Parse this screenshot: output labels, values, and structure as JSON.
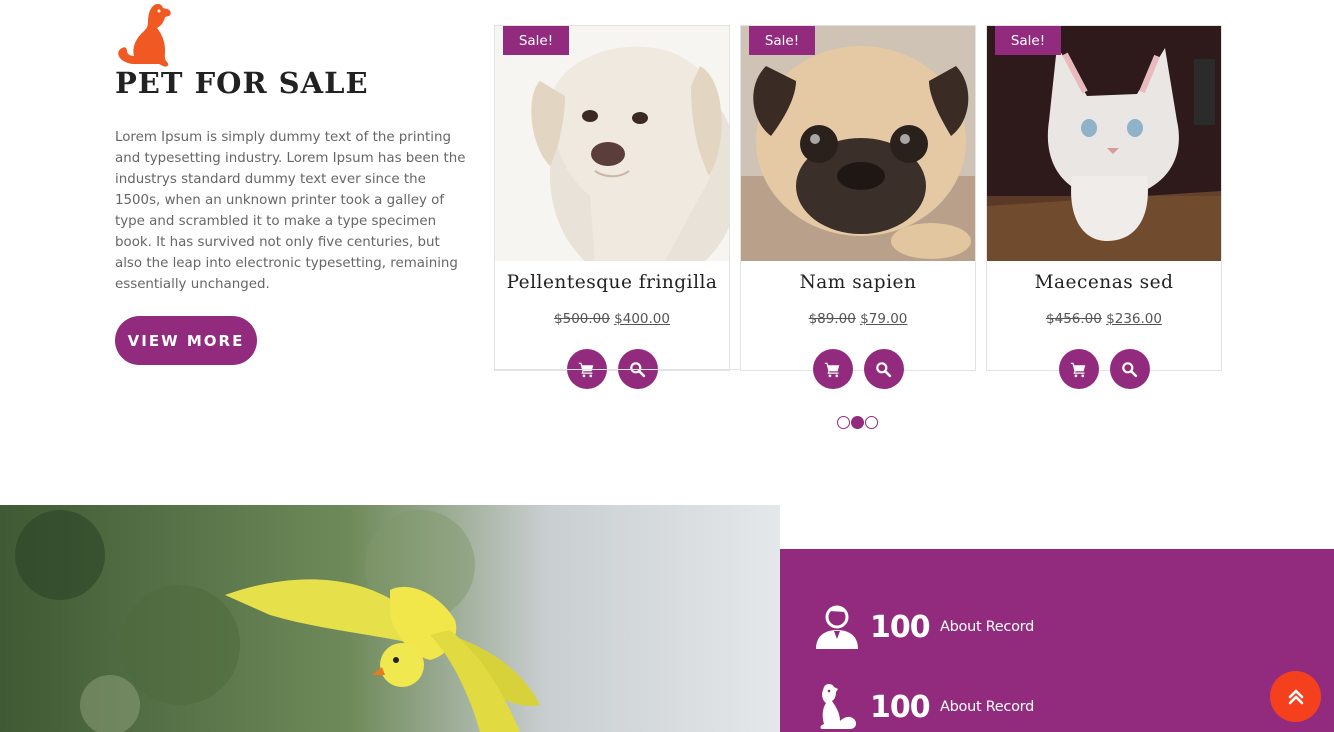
{
  "intro": {
    "title": "PET FOR SALE",
    "description": "Lorem Ipsum is simply dummy text of the printing and typesetting industry. Lorem Ipsum has been the industrys standard dummy text ever since the 1500s, when an unknown printer took a galley of type and scrambled it to make a type specimen book. It has survived not only five centuries, but also the leap into electronic typesetting, remaining essentially unchanged.",
    "button_label": "VIEW MORE",
    "logo_icon": "dog-sitting-icon"
  },
  "products": [
    {
      "badge": "Sale!",
      "name": "Pellentesque fringilla",
      "old_price": "$500.00",
      "new_price": "$400.00",
      "image": "white-dog"
    },
    {
      "badge": "Sale!",
      "name": "Nam sapien",
      "old_price": "$89.00",
      "new_price": "$79.00",
      "image": "pug"
    },
    {
      "badge": "Sale!",
      "name": "Maecenas sed",
      "old_price": "$456.00",
      "new_price": "$236.00",
      "image": "white-kitten"
    }
  ],
  "product_actions": {
    "cart_icon": "shopping-cart-icon",
    "search_icon": "magnifier-icon"
  },
  "carousel": {
    "pages": 3,
    "active_page": 2
  },
  "stats": [
    {
      "icon": "person-icon",
      "number": "100",
      "label": "About Record"
    },
    {
      "icon": "dog-icon",
      "number": "100",
      "label": "About Record"
    }
  ],
  "colors": {
    "accent": "#922b7e",
    "scroll_top": "#f5401d",
    "logo": "#f05a22"
  },
  "scroll_top_icon": "double-chevron-up-icon"
}
